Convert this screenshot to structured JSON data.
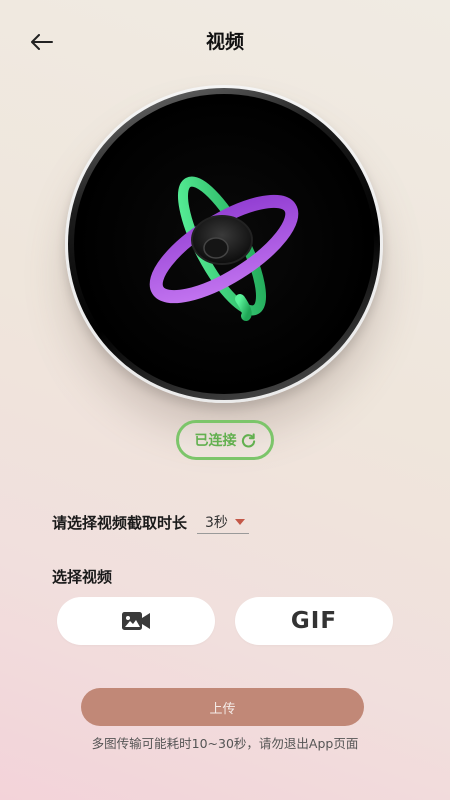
{
  "header": {
    "title": "视频",
    "back_icon": "arrow-left-icon"
  },
  "device": {
    "logo_icon": "orbit-logo-icon",
    "accent_green": "#3ddc7a",
    "accent_purple": "#b45be6"
  },
  "status": {
    "label": "已连接",
    "refresh_icon": "refresh-icon",
    "color": "#62b04f"
  },
  "duration": {
    "label": "请选择视频截取时长",
    "selected": "3秒",
    "caret_icon": "caret-down-icon"
  },
  "select_video": {
    "label": "选择视频",
    "video_icon": "video-camera-icon",
    "gif_label": "GIF"
  },
  "upload": {
    "label": "上传",
    "color": "#c18877"
  },
  "hint": "多图传输可能耗时10~30秒，请勿退出App页面"
}
